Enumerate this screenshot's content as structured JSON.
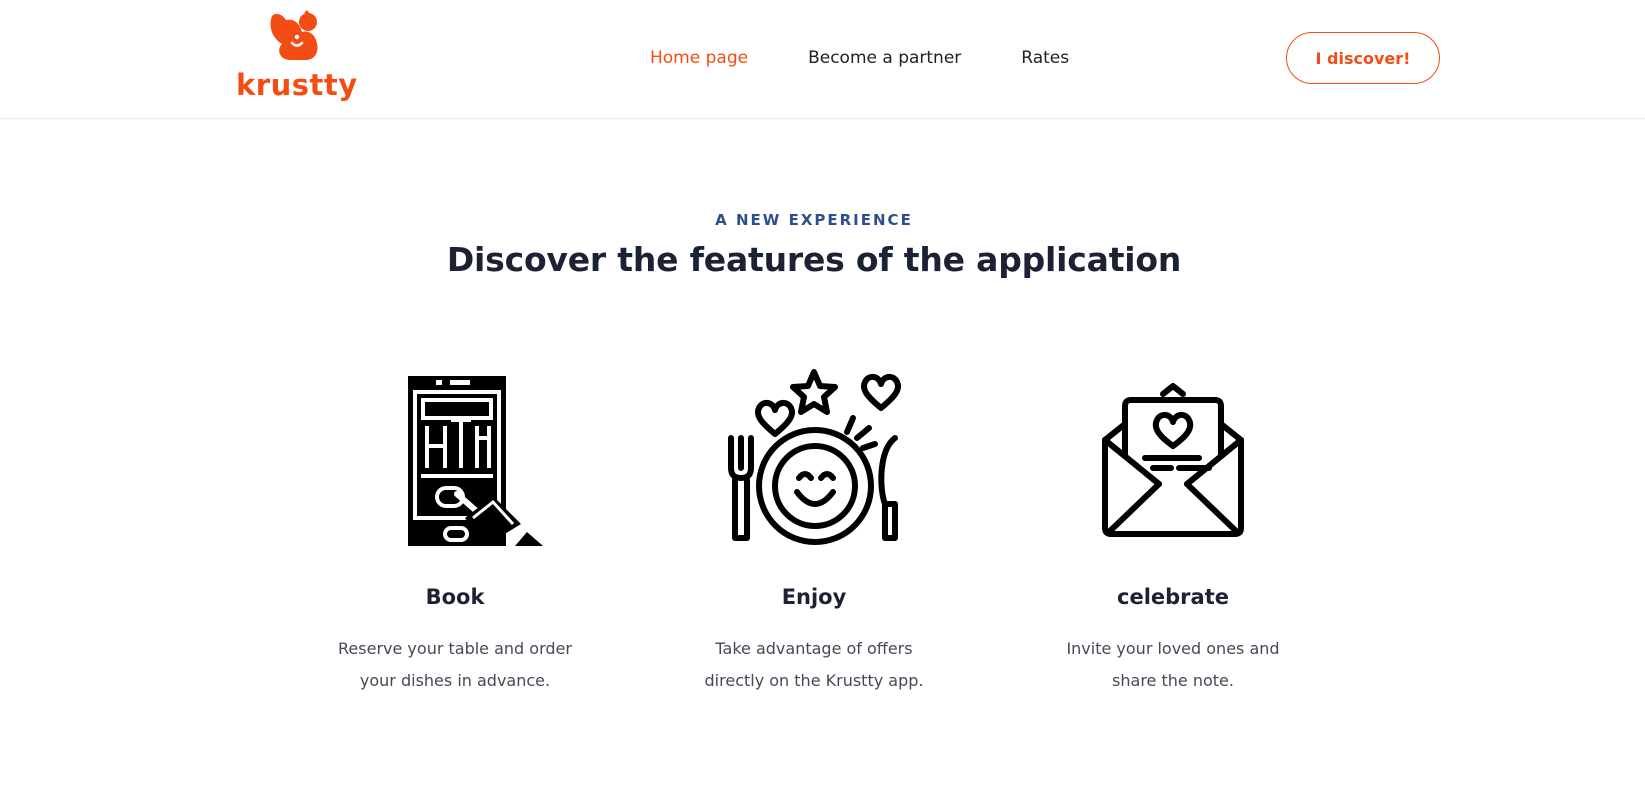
{
  "brand": {
    "name": "krustty",
    "accent": "#f24d14",
    "logo_icon": "squirrel-icon"
  },
  "nav": {
    "items": [
      {
        "label": "Home page",
        "active": true
      },
      {
        "label": "Become a partner",
        "active": false
      },
      {
        "label": "Rates",
        "active": false
      }
    ],
    "cta_label": "I discover!"
  },
  "features_section": {
    "eyebrow": "A NEW EXPERIENCE",
    "heading": "Discover the features of the application",
    "heading_color": "#1b2233",
    "eyebrow_color": "#2f4f8c",
    "items": [
      {
        "icon": "phone-menu-icon",
        "title": "Book",
        "description": "Reserve your table and order your dishes in advance."
      },
      {
        "icon": "plate-smile-icon",
        "title": "Enjoy",
        "description": "Take advantage of offers directly on the Krustty app."
      },
      {
        "icon": "envelope-heart-icon",
        "title": "celebrate",
        "description": "Invite your loved ones and share the note."
      }
    ]
  }
}
